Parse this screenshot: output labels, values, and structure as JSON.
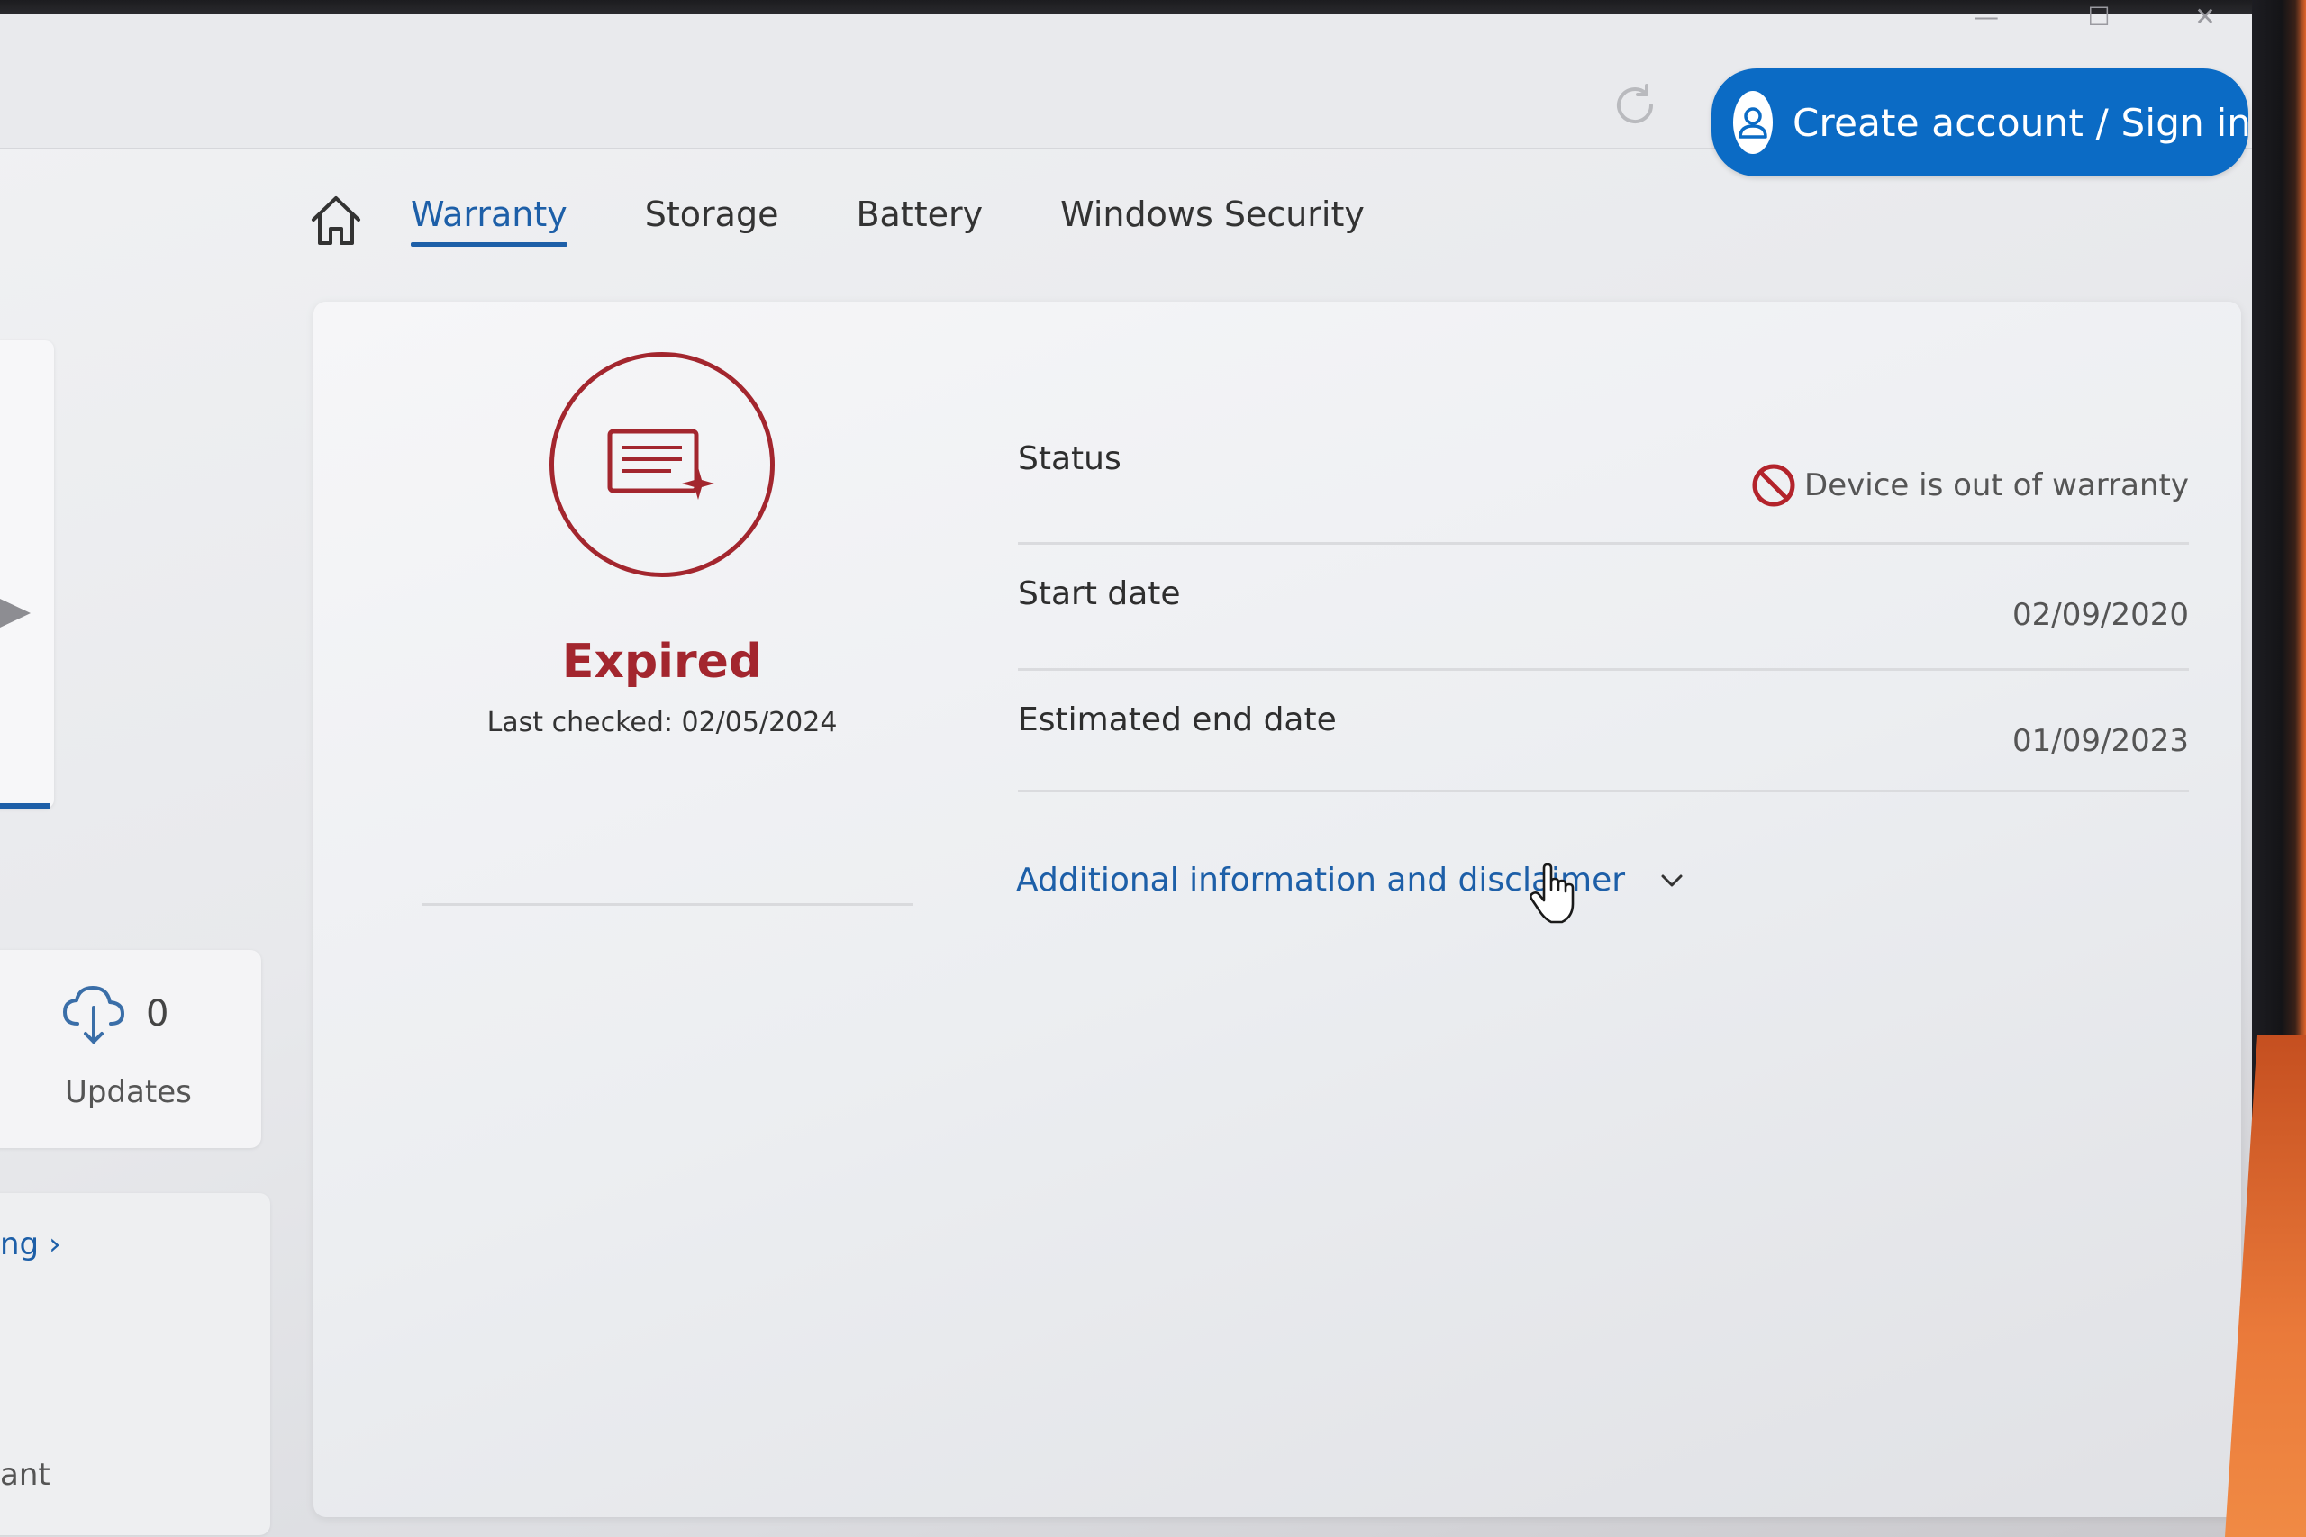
{
  "window_controls": {
    "minimize": "—",
    "maximize": "☐",
    "close": "✕"
  },
  "header": {
    "signin_label": "Create account / Sign in",
    "accent_color": "#0b6bc5"
  },
  "tabs": [
    {
      "label": "Warranty",
      "active": true
    },
    {
      "label": "Storage",
      "active": false
    },
    {
      "label": "Battery",
      "active": false
    },
    {
      "label": "Windows Security",
      "active": false
    }
  ],
  "sidebar": {
    "updates": {
      "count": "0",
      "label": "Updates"
    },
    "link_fragment": "ng ›",
    "text_fragment": "ant"
  },
  "warranty": {
    "state": "Expired",
    "state_color": "#a3262e",
    "last_checked": "Last checked: 02/05/2024",
    "rows": [
      {
        "label": "Status",
        "value": "Device is out of warranty"
      },
      {
        "label": "Start date",
        "value": "02/09/2020"
      },
      {
        "label": "Estimated end date",
        "value": "01/09/2023"
      }
    ],
    "disclaimer_link": "Additional information and disclaimer"
  }
}
